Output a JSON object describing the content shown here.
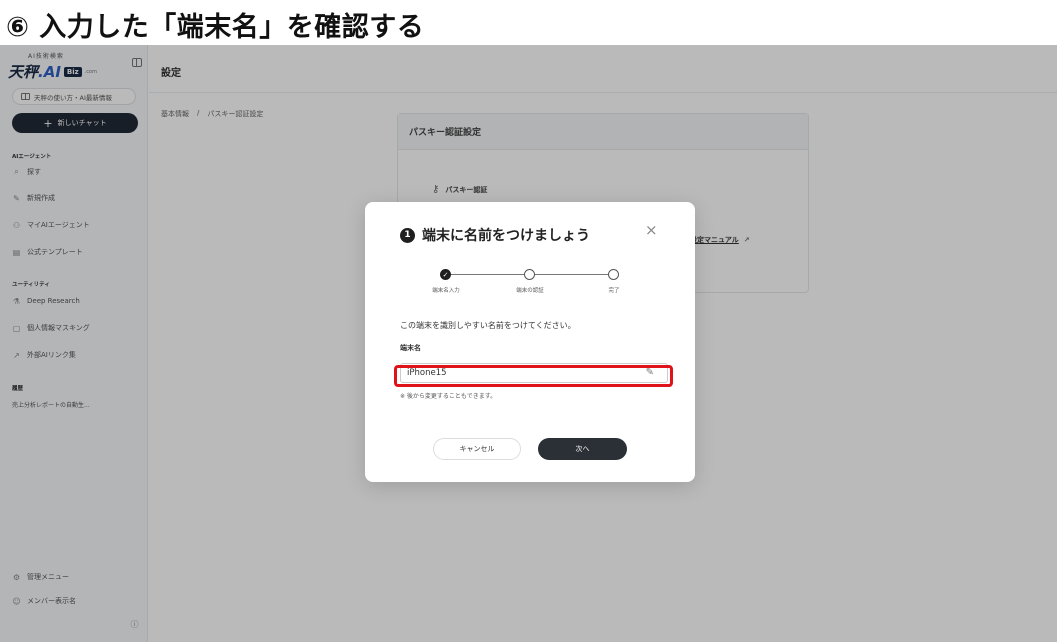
{
  "heading": "⑥ 入力した「端末名」を確認する",
  "sidebar": {
    "brand_sub": "AI技術検索",
    "brand_logo_main": "天秤",
    "brand_logo_ai": ".AI",
    "brand_badge": "Biz",
    "brand_tail": ".com",
    "guide_label": "天秤の使い方・AI最新情報",
    "new_chat_label": "新しいチャット",
    "sections": {
      "agent": "AIエージェント",
      "utility": "ユーティリティ",
      "history": "履歴"
    },
    "agent_items": [
      {
        "label": "探す",
        "icon": "search-icon"
      },
      {
        "label": "新規作成",
        "icon": "wand-icon"
      },
      {
        "label": "マイAIエージェント",
        "icon": "agent-icon"
      },
      {
        "label": "公式テンプレート",
        "icon": "template-icon"
      }
    ],
    "utility_items": [
      {
        "label": "Deep Research",
        "icon": "flask-icon"
      },
      {
        "label": "個人情報マスキング",
        "icon": "document-icon"
      },
      {
        "label": "外部AIリンク集",
        "icon": "external-link-icon"
      }
    ],
    "history_items": [
      {
        "label": "売上分析レポートの自動生..."
      }
    ],
    "admin_menu": "管理メニュー",
    "member_label": "メンバー表示名"
  },
  "main": {
    "page_title": "設定",
    "breadcrumb": [
      "基本情報",
      "/",
      "パスキー認証設定"
    ],
    "card_title": "パスキー認証設定",
    "card_subtitle": "パスキー認証",
    "manual_link": "設定マニュアル"
  },
  "modal": {
    "step_number": "1",
    "title": "端末に名前をつけましょう",
    "close_symbol": "×",
    "steps": [
      {
        "label": "端末名入力",
        "status": "done"
      },
      {
        "label": "端末の認証",
        "status": "pending"
      },
      {
        "label": "完了",
        "status": "pending"
      }
    ],
    "instruction": "この端末を識別しやすい名前をつけてください。",
    "field_label": "端末名",
    "field_value": "iPhone15",
    "note": "※ 後から変更することもできます。",
    "cancel_label": "キャンセル",
    "next_label": "次へ"
  },
  "colors": {
    "highlight": "#e0121a",
    "primary_button": "#2b2f36",
    "new_chat": "#222a36"
  }
}
